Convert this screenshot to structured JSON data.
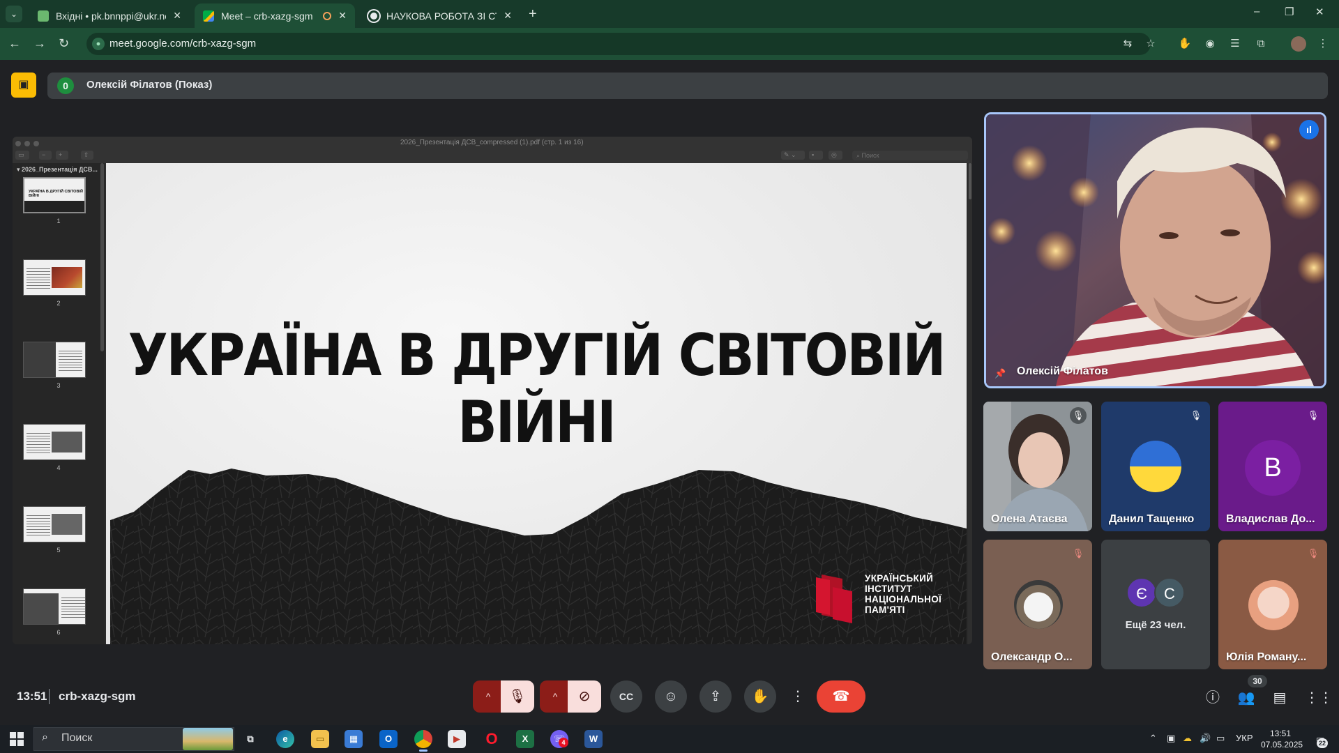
{
  "browser": {
    "tabs": [
      {
        "title": "Вхідні • pk.bnnppi@ukr.net",
        "favicon_color": "#4caf50"
      },
      {
        "title": "Meet – crb-xazg-sgm",
        "favicon_color": "#34a853"
      },
      {
        "title": "НАУКОВА РОБОТА ЗІ СТУДЕНТ",
        "favicon_color": "#e8eaed"
      }
    ],
    "url": "meet.google.com/crb-xazg-sgm",
    "new_tab_label": "+",
    "window_controls": {
      "minimize": "–",
      "restore": "❐",
      "close": "✕"
    }
  },
  "meet": {
    "presentation_count": "0",
    "presenter_label": "Олексій Філатов (Показ)",
    "main_speaker": "Олексій Філатов",
    "participants": [
      {
        "name": "Олена Атаєва",
        "muted": true
      },
      {
        "name": "Данил Тащенко",
        "muted": true
      },
      {
        "name": "Владислав До...",
        "initial": "В",
        "muted": true
      },
      {
        "name": "Олександр О...",
        "muted": true
      },
      {
        "name": "Юлія Роману...",
        "muted": true
      }
    ],
    "more_tile": {
      "initials": [
        "Є",
        "С"
      ],
      "label": "Ещё 23 чел."
    },
    "time": "13:51",
    "meeting_code": "crb-xazg-sgm",
    "people_count": "30",
    "colors": {
      "hangup": "#ea4335",
      "mic_off_bg": "#f9dedc",
      "accent_border": "#a8c7fa"
    }
  },
  "viewer": {
    "file_title": "2026_Презентація ДСВ_compressed (1).pdf (стр. 1 из 16)",
    "sidebar_title": "2026_Презентація ДСВ...",
    "search_placeholder": "Поиск",
    "thumbnails": [
      "1",
      "2",
      "3",
      "4",
      "5",
      "6"
    ],
    "thumb_title": "УКРАЇНА В ДРУГІЙ СВІТОВІЙ ВІЙНІ"
  },
  "slide": {
    "title": "УКРАЇНА В ДРУГІЙ СВІТОВІЙ ВІЙНІ",
    "logo_text": "УКРАЇНСЬКИЙ\nІНСТИТУТ\nНАЦІОНАЛЬНОЇ\nПАМ'ЯТІ",
    "logo_color": "#c8102e"
  },
  "taskbar": {
    "search_placeholder": "Поиск",
    "viber_badge": "4",
    "language": "УКР",
    "clock_time": "13:51",
    "clock_date": "07.05.2025",
    "notification_count": "22"
  }
}
